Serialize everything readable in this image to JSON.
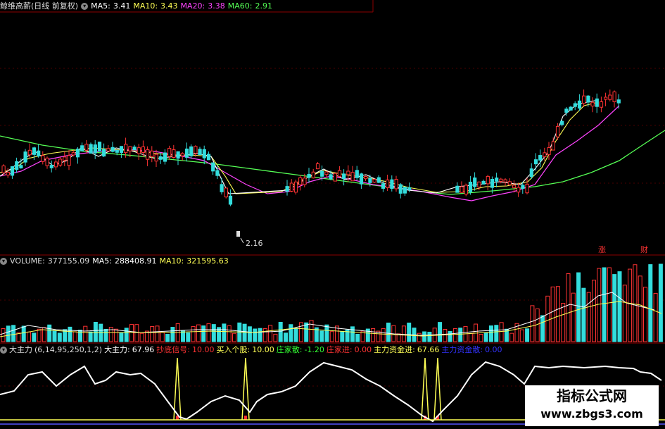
{
  "main_panel": {
    "title": "鲸维高薪(日线 前复权)",
    "ma_items": [
      {
        "label": "MA5:",
        "value": "3.41",
        "color": "#ffffff"
      },
      {
        "label": "MA10:",
        "value": "3.43",
        "color": "#ffff55"
      },
      {
        "label": "MA20:",
        "value": "3.38",
        "color": "#ff44ff"
      },
      {
        "label": "MA60:",
        "value": "2.91",
        "color": "#55ff55"
      }
    ],
    "low_price_label": "2.16",
    "badge_left": "涨",
    "badge_right": "财"
  },
  "volume_panel": {
    "label": "VOLUME:",
    "value": "377155.09",
    "ma5_label": "MA5:",
    "ma5_value": "288408.91",
    "ma10_label": "MA10:",
    "ma10_value": "321595.63"
  },
  "indicator_panel": {
    "name": "大主力",
    "params": "(6,14,95,250,1,2)",
    "items": [
      {
        "label": "大主力:",
        "value": "67.96",
        "color": "#ffffff"
      },
      {
        "label": "抄底信号:",
        "value": "10.00",
        "color": "#ff3333"
      },
      {
        "label": "买入个股:",
        "value": "10.00",
        "color": "#ffff55"
      },
      {
        "label": "庄家散:",
        "value": "-1.20",
        "color": "#33ff33"
      },
      {
        "label": "庄家进:",
        "value": "0.00",
        "color": "#ff3333"
      },
      {
        "label": "主力资金进:",
        "value": "67.66",
        "color": "#ffff55"
      },
      {
        "label": "主力资金散:",
        "value": "0.00",
        "color": "#3333ff"
      }
    ]
  },
  "watermark": {
    "line1": "指标公式网",
    "line2": "www.zbgs3.com"
  },
  "colors": {
    "up": "#ff3333",
    "down": "#33dddd",
    "ma5": "#ffffff",
    "ma10": "#ffff55",
    "ma20": "#ff44ff",
    "ma60": "#55ff55",
    "grid": "#8b0000"
  }
}
